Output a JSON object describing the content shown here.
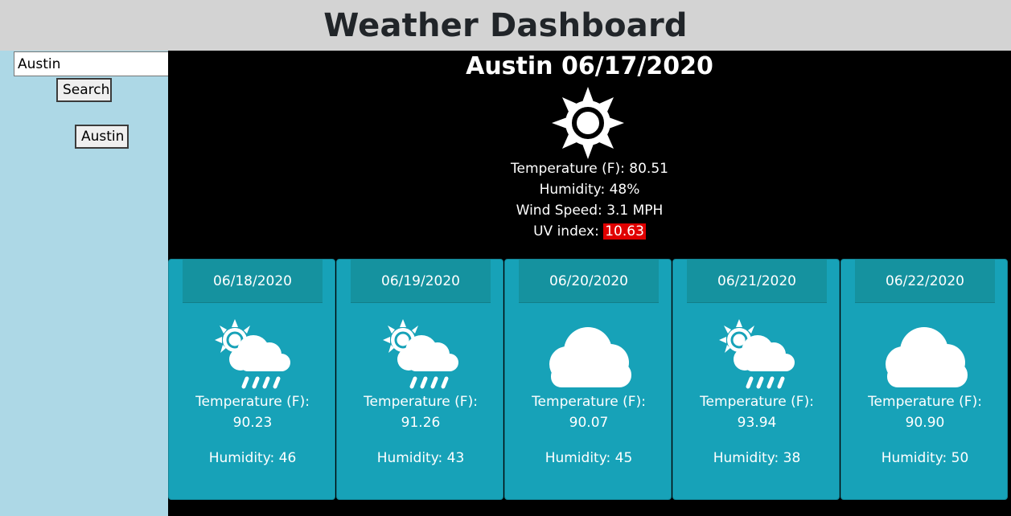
{
  "header": {
    "title": "Weather Dashboard"
  },
  "sidebar": {
    "search_value": "Austin",
    "search_button": "Search",
    "history": [
      "Austin"
    ]
  },
  "current": {
    "heading": "Austin 06/17/2020",
    "icon": "sun-icon",
    "temperature_line": "Temperature (F): 80.51",
    "humidity_line": "Humidity: 48%",
    "wind_line": "Wind Speed: 3.1 MPH",
    "uv_label": "UV index:",
    "uv_value": "10.63",
    "uv_color": "#e00000"
  },
  "forecast": [
    {
      "date": "06/18/2020",
      "icon": "sun-cloud-rain-icon",
      "temp_label": "Temperature (F):",
      "temp": "90.23",
      "humidity": "Humidity: 46"
    },
    {
      "date": "06/19/2020",
      "icon": "sun-cloud-rain-icon",
      "temp_label": "Temperature (F):",
      "temp": "91.26",
      "humidity": "Humidity: 43"
    },
    {
      "date": "06/20/2020",
      "icon": "cloud-icon",
      "temp_label": "Temperature (F):",
      "temp": "90.07",
      "humidity": "Humidity: 45"
    },
    {
      "date": "06/21/2020",
      "icon": "sun-cloud-rain-icon",
      "temp_label": "Temperature (F):",
      "temp": "93.94",
      "humidity": "Humidity: 38"
    },
    {
      "date": "06/22/2020",
      "icon": "cloud-icon",
      "temp_label": "Temperature (F):",
      "temp": "90.90",
      "humidity": "Humidity: 50"
    }
  ],
  "colors": {
    "header_bg": "#d3d3d3",
    "sidebar_bg": "#add8e6",
    "card_bg": "#17a2b8"
  }
}
